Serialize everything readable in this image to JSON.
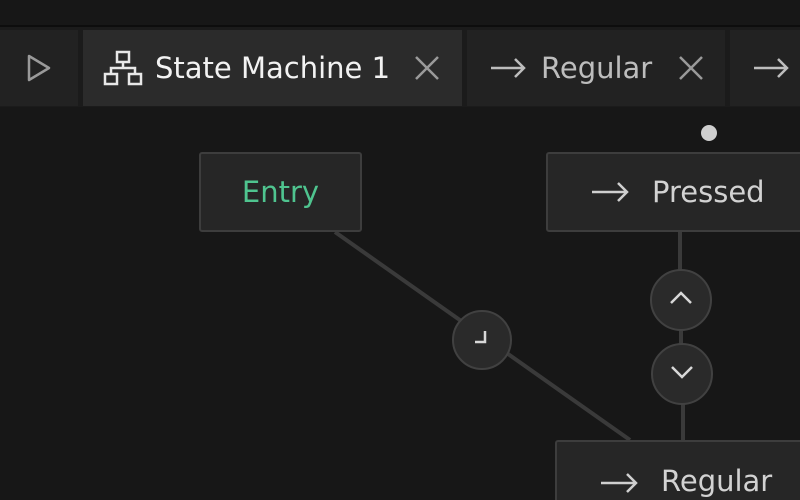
{
  "tabs": [
    {
      "label": "State Machine 1",
      "icon": "state-machine-icon",
      "active": true
    },
    {
      "label": "Regular",
      "icon": "arrow-right-icon",
      "active": false
    },
    {
      "label": "",
      "icon": "arrow-right-icon",
      "active": false
    }
  ],
  "play_icon": "play-icon",
  "nodes": {
    "entry": {
      "label": "Entry",
      "color": "#4fc48f"
    },
    "pressed": {
      "label": "Pressed",
      "icon": "arrow-right-icon"
    },
    "regular": {
      "label": "Regular",
      "icon": "arrow-right-icon"
    }
  },
  "transition_icons": [
    "timer-corner-icon",
    "chevron-up-icon",
    "chevron-down-icon"
  ]
}
